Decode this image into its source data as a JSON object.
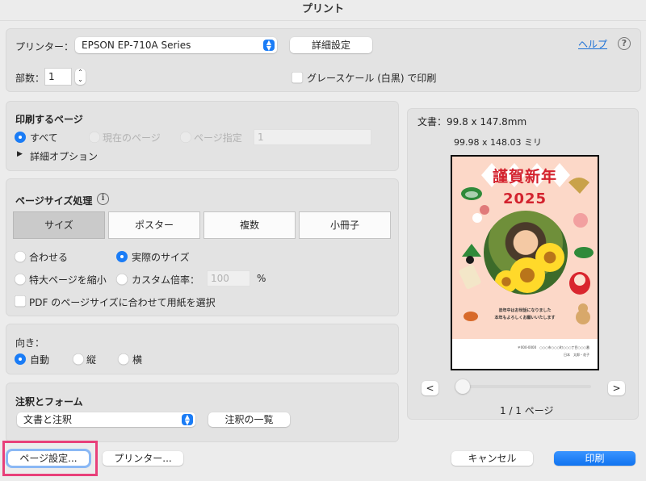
{
  "window": {
    "title": "プリント"
  },
  "printer": {
    "label": "プリンター：",
    "selected": "EPSON EP-710A Series",
    "details_button": "詳細設定",
    "help_link": "ヘルプ",
    "help_icon": "?",
    "copies_label": "部数：",
    "copies_value": "1",
    "grayscale_label": "グレースケール (白黒) で印刷",
    "grayscale_checked": false
  },
  "pages": {
    "heading": "印刷するページ",
    "options": [
      {
        "label": "すべて",
        "selected": true,
        "enabled": true
      },
      {
        "label": "現在のページ",
        "selected": false,
        "enabled": false
      },
      {
        "label": "ページ指定",
        "selected": false,
        "enabled": false
      }
    ],
    "range_value": "1",
    "details_disclosure": "詳細オプション"
  },
  "page_sizing": {
    "heading": "ページサイズ処理",
    "info_icon": "i",
    "tabs": [
      {
        "label": "サイズ",
        "selected": true
      },
      {
        "label": "ポスター",
        "selected": false
      },
      {
        "label": "複数",
        "selected": false
      },
      {
        "label": "小冊子",
        "selected": false
      }
    ],
    "options": [
      {
        "label": "合わせる",
        "selected": false
      },
      {
        "label": "実際のサイズ",
        "selected": true
      },
      {
        "label": "特大ページを縮小",
        "selected": false
      },
      {
        "label": "カスタム倍率：",
        "selected": false
      }
    ],
    "custom_scale_value": "100",
    "percent_sign": "%",
    "pdf_paper_label": "PDF のページサイズに合わせて用紙を選択",
    "pdf_paper_checked": false
  },
  "orientation": {
    "heading": "向き：",
    "options": [
      {
        "label": "自動",
        "selected": true
      },
      {
        "label": "縦",
        "selected": false
      },
      {
        "label": "横",
        "selected": false
      }
    ]
  },
  "annotations": {
    "heading": "注釈とフォーム",
    "selected": "文書と注釈",
    "list_button": "注釈の一覧"
  },
  "preview": {
    "document_size": "文書：99.8 x 147.8mm",
    "paper_size": "99.98 x 148.03 ミリ",
    "card": {
      "greeting": "謹賀新年",
      "year": "2025",
      "message_line1": "旧年中はお世話になりました",
      "message_line2": "本年もよろしくお願いいたします",
      "address_line1": "〒000-0000　○○○市○○○町○○○丁目○○○番",
      "address_line2": "日本　太郎・花子"
    },
    "prev_button": "<",
    "next_button": ">",
    "page_indicator": "1 / 1 ページ",
    "slider_position": 0
  },
  "footer": {
    "page_setup_button": "ページ設定...",
    "printer_button": "プリンター...",
    "cancel_button": "キャンセル",
    "print_button": "印刷"
  },
  "colors": {
    "accent": "#1a7cf6",
    "highlight": "#e8407a",
    "link": "#1a6fd6"
  }
}
